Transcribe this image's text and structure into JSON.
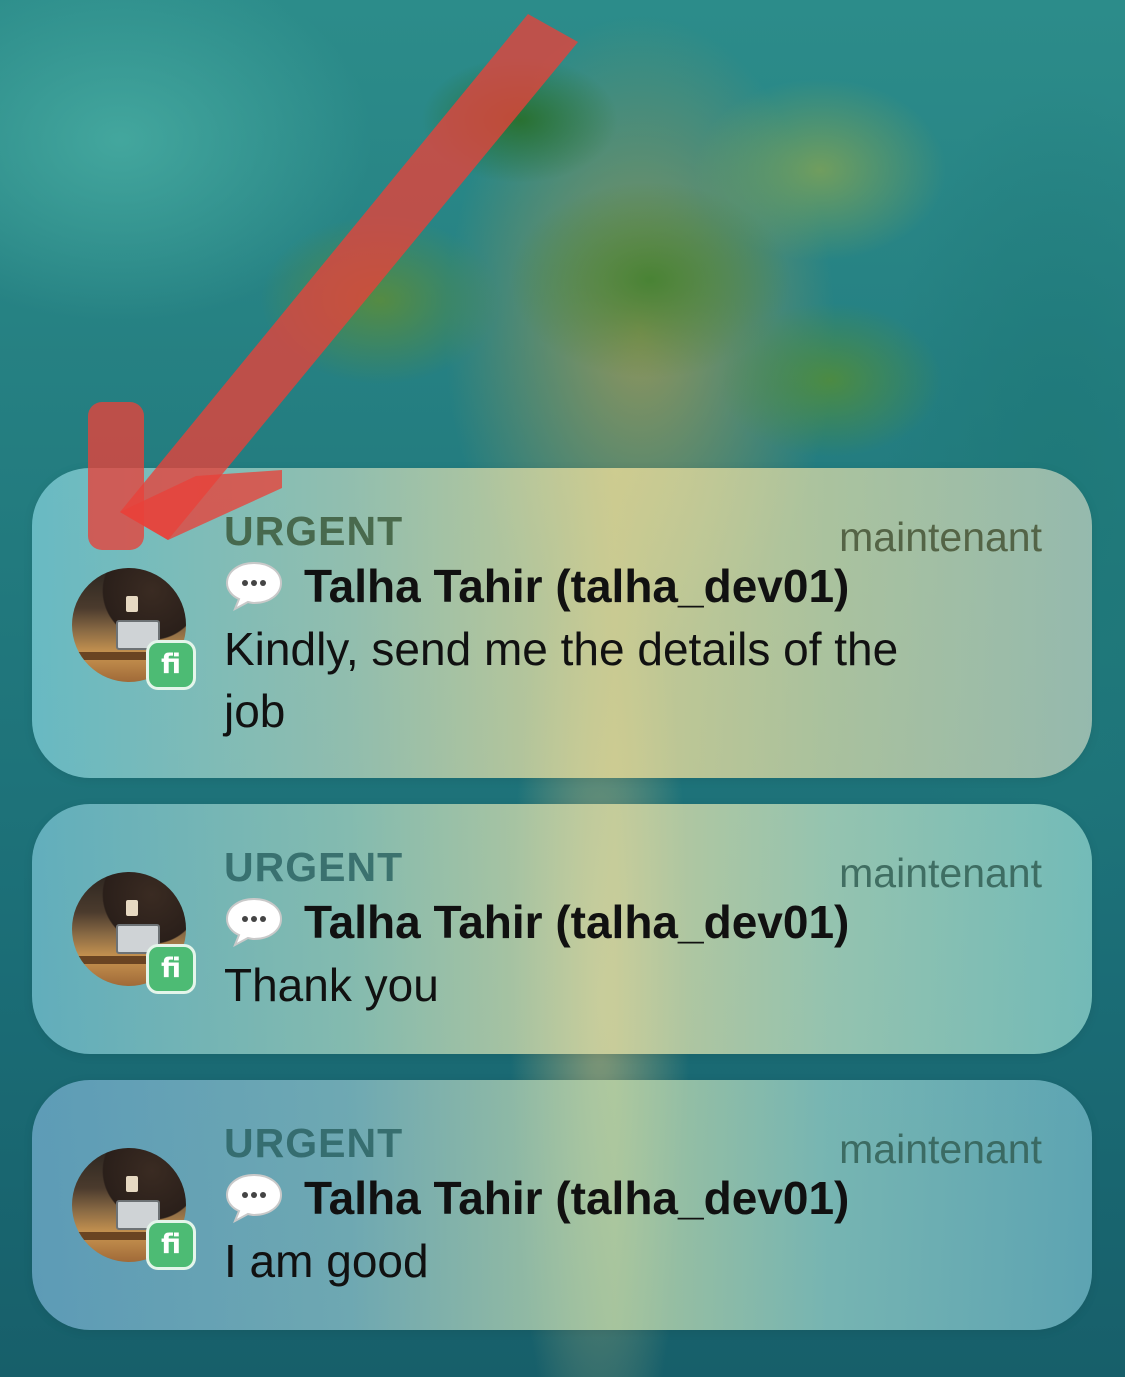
{
  "wallpaper": {
    "description_icon": "aerial-island-wallpaper"
  },
  "annotation": {
    "icon": "red-arrow-annotation",
    "color": "#e8413a"
  },
  "notifications": [
    {
      "category": "URGENT",
      "time": "maintenant",
      "sender": "Talha Tahir (talha_dev01)",
      "message": "Kindly, send me the details of the job",
      "app_badge": "fi",
      "badge_color": "#4dbb74",
      "message_icon": "speech-bubble-icon"
    },
    {
      "category": "URGENT",
      "time": "maintenant",
      "sender": "Talha Tahir (talha_dev01)",
      "message": "Thank you",
      "app_badge": "fi",
      "badge_color": "#4dbb74",
      "message_icon": "speech-bubble-icon"
    },
    {
      "category": "URGENT",
      "time": "maintenant",
      "sender": "Talha Tahir (talha_dev01)",
      "message": "I am good",
      "app_badge": "fi",
      "badge_color": "#4dbb74",
      "message_icon": "speech-bubble-icon"
    }
  ]
}
